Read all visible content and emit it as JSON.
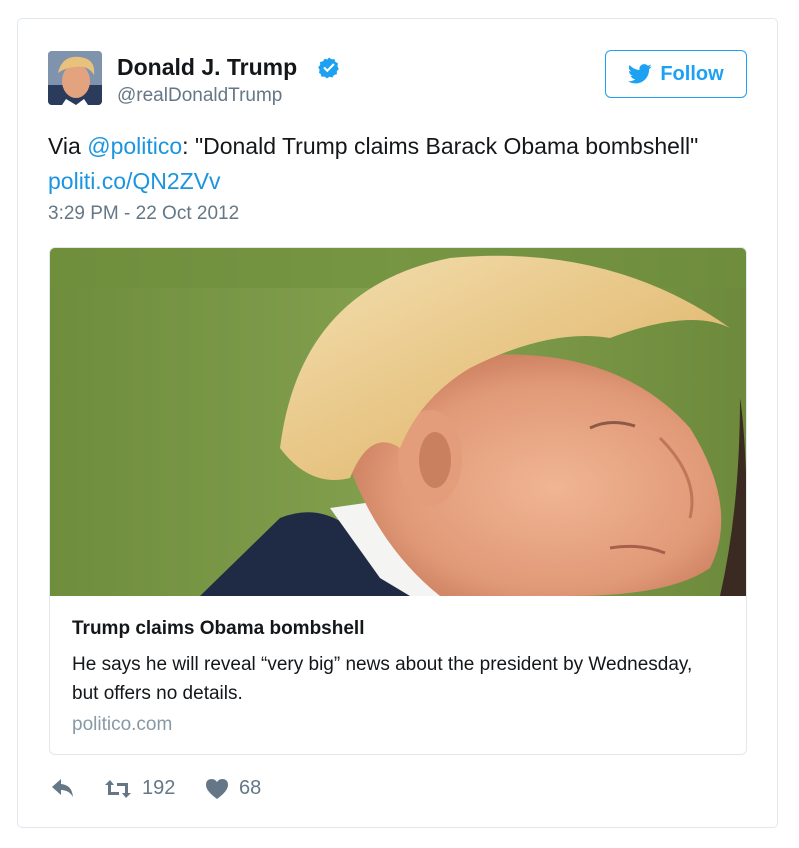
{
  "author": {
    "name": "Donald J. Trump",
    "handle": "@realDonaldTrump",
    "verified": true
  },
  "follow_button": {
    "label": "Follow",
    "icon": "twitter-bird-icon"
  },
  "tweet": {
    "prefix": "Via ",
    "mention": "@politico",
    "quote": ": \"Donald Trump claims Barack Obama bombshell\"",
    "link": "politi.co/QN2ZVv",
    "timestamp": "3:29 PM - 22 Oct 2012"
  },
  "card": {
    "image": "trump-portrait-photo",
    "title": "Trump claims Obama bombshell",
    "description": "He says he will reveal “very big” news about the president by Wednesday, but offers no details.",
    "domain": "politico.com"
  },
  "actions": {
    "reply": {
      "icon": "reply-icon"
    },
    "retweet": {
      "icon": "retweet-icon",
      "count": "192"
    },
    "like": {
      "icon": "heart-icon",
      "count": "68"
    }
  },
  "colors": {
    "twitter_blue": "#1da1f2",
    "link_blue": "#1b95e0",
    "muted_text": "#657786",
    "border": "#e1e8ed"
  }
}
